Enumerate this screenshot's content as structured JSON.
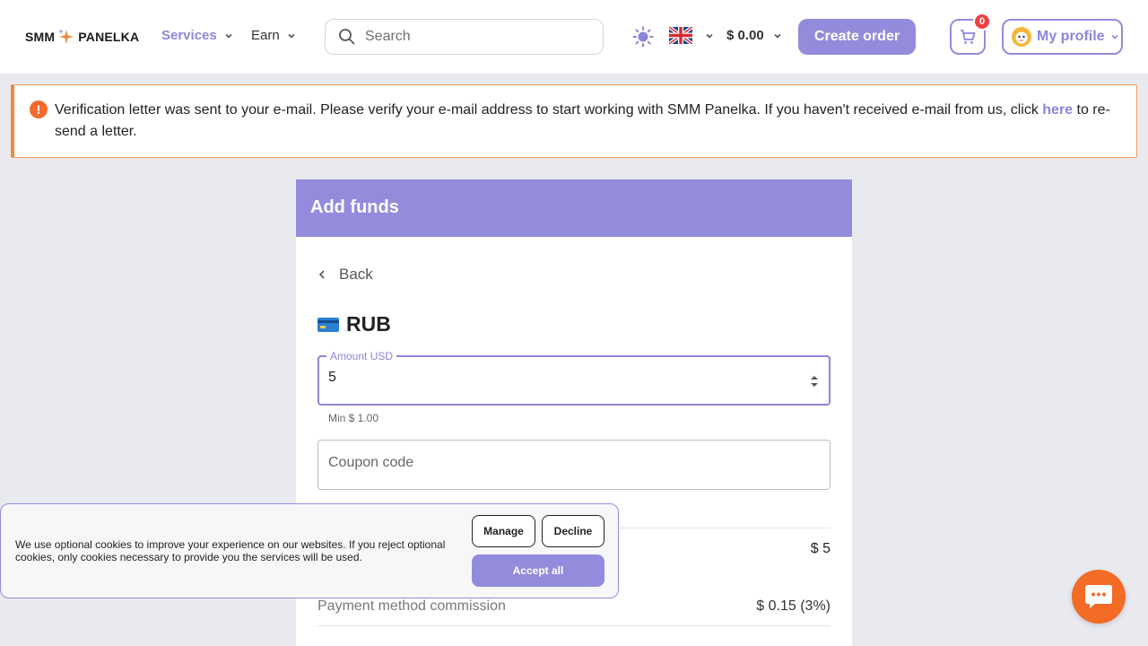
{
  "header": {
    "logo_left": "SMM",
    "logo_right": "PANELKA",
    "nav": [
      {
        "label": "Services",
        "icon": "chevron-down-icon"
      },
      {
        "label": "Earn",
        "icon": "chevron-down-icon"
      }
    ],
    "search_placeholder": "Search",
    "balance": "$ 0.00",
    "create_order": "Create order",
    "cart_count": "0",
    "profile_label": "My profile"
  },
  "alert": {
    "text_before": "Verification letter was sent to your e-mail. Please verify your e-mail address to start working with SMM Panelka. If you haven't received e-mail from us, click ",
    "link": "here",
    "text_after": " to re-send a letter."
  },
  "card": {
    "title": "Add funds",
    "back": "Back",
    "method": "RUB",
    "amount_label": "Amount USD",
    "amount_value": "5",
    "amount_helper": "Min $ 1.00",
    "coupon_placeholder": "Coupon code",
    "amount_total": "$ 5",
    "commission_label": "Payment method commission",
    "commission_value": "$ 0.15 (3%)"
  },
  "cookie": {
    "text": "We use optional cookies to improve your experience on our websites. If you reject optional cookies, only cookies necessary to provide you the services will be used.",
    "manage": "Manage",
    "decline": "Decline",
    "accept": "Accept all"
  },
  "colors": {
    "accent": "#938cdc",
    "alert": "#f26b2b",
    "chat": "#f36b25",
    "badge": "#ef4141"
  }
}
